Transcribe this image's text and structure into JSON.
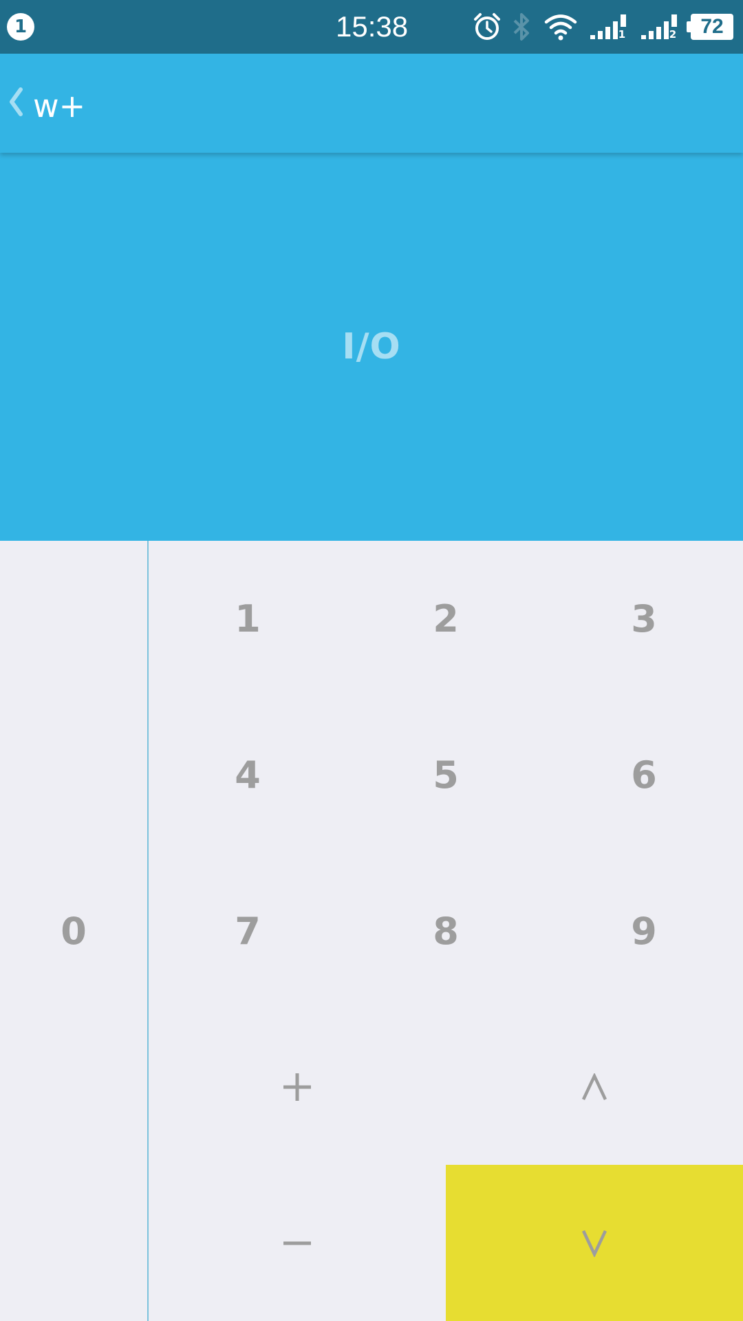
{
  "status_bar": {
    "notification_count": "1",
    "time": "15:38",
    "battery_level": "72",
    "icons": [
      "alarm-icon",
      "bluetooth-icon",
      "wifi-icon",
      "signal-sim1-icon",
      "signal-sim2-icon",
      "battery-icon"
    ],
    "sim1_label": "1",
    "sim2_label": "2"
  },
  "toolbar": {
    "back_icon": "chevron-left-icon",
    "title": "w+"
  },
  "display": {
    "text": "I/O"
  },
  "keypad": {
    "zero": "0",
    "digits": [
      "1",
      "2",
      "3",
      "4",
      "5",
      "6",
      "7",
      "8",
      "9"
    ],
    "plus": "+",
    "caret": "^",
    "minus": "−",
    "v": "v"
  },
  "colors": {
    "status_bar": "#1f6d8a",
    "primary": "#33b4e4",
    "display_text": "#a6def3",
    "keypad_bg": "#eeeef4",
    "key_text": "#9d9d9d",
    "highlight_key": "#e7dd31",
    "divider": "#7cc2dc"
  }
}
